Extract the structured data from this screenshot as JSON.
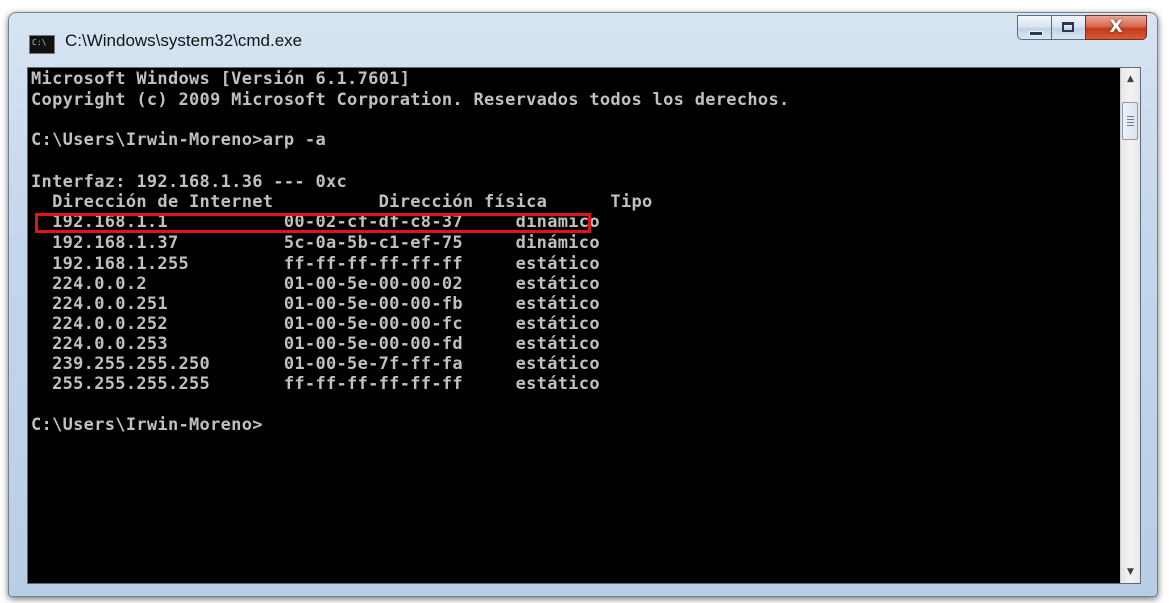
{
  "window": {
    "title": "C:\\Windows\\system32\\cmd.exe",
    "icon_text": "C:\\",
    "buttons": {
      "minimize": "minimize-icon",
      "maximize": "maximize-icon",
      "close_glyph": "X"
    }
  },
  "console": {
    "lines": [
      "Microsoft Windows [Versión 6.1.7601]",
      "Copyright (c) 2009 Microsoft Corporation. Reservados todos los derechos.",
      "",
      "C:\\Users\\Irwin-Moreno>arp -a",
      "",
      "Interfaz: 192.168.1.36 --- 0xc",
      "  Dirección de Internet          Dirección física      Tipo",
      "  192.168.1.1           00-02-cf-df-c8-37     dinámico",
      "  192.168.1.37          5c-0a-5b-c1-ef-75     dinámico",
      "  192.168.1.255         ff-ff-ff-ff-ff-ff     estático",
      "  224.0.0.2             01-00-5e-00-00-02     estático",
      "  224.0.0.251           01-00-5e-00-00-fb     estático",
      "  224.0.0.252           01-00-5e-00-00-fc     estático",
      "  224.0.0.253           01-00-5e-00-00-fd     estático",
      "  239.255.255.250       01-00-5e-7f-ff-fa     estático",
      "  255.255.255.255       ff-ff-ff-ff-ff-ff     estático",
      "",
      "C:\\Users\\Irwin-Moreno>"
    ],
    "text_color": "#c0c0c0",
    "background_color": "#000000",
    "highlight_color": "#e0141a"
  },
  "scrollbar": {
    "up_arrow": "▲",
    "down_arrow": "▼"
  }
}
